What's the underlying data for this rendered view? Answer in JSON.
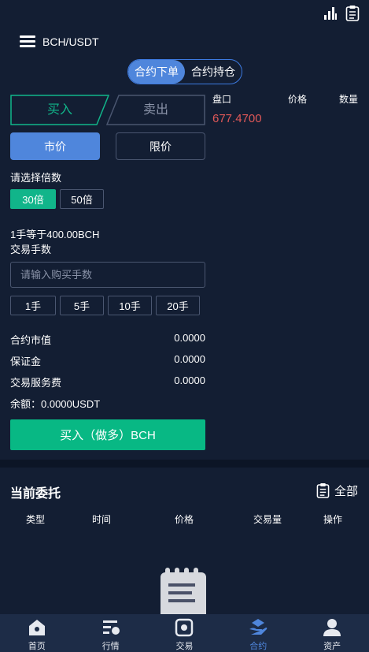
{
  "header": {
    "pair": "BCH/USDT"
  },
  "segment": {
    "tabs": [
      "合约下单",
      "合约持仓"
    ],
    "active": 0
  },
  "trade": {
    "buy_label": "买入",
    "sell_label": "卖出",
    "market_label": "市价",
    "limit_label": "限价",
    "leverage_title": "请选择倍数",
    "leverages": [
      "30倍",
      "50倍"
    ],
    "lot_info": "1手等于400.00BCH",
    "qty_title": "交易手数",
    "qty_placeholder": "请输入购买手数",
    "qty_chips": [
      "1手",
      "5手",
      "10手",
      "20手"
    ],
    "contract_value_label": "合约市值",
    "contract_value": "0.0000",
    "margin_label": "保证金",
    "margin": "0.0000",
    "fee_label": "交易服务费",
    "fee": "0.0000",
    "balance": "余额：0.0000USDT",
    "submit_label": "买入（做多）BCH"
  },
  "orderbook": {
    "title": "盘口",
    "price_header": "价格",
    "qty_header": "数量",
    "last_price": "677.4700"
  },
  "orders": {
    "title": "当前委托",
    "all_label": "全部",
    "columns": [
      "类型",
      "时间",
      "价格",
      "交易量",
      "操作"
    ]
  },
  "tabbar": {
    "items": [
      {
        "label": "首页",
        "icon": "home-icon"
      },
      {
        "label": "行情",
        "icon": "market-icon"
      },
      {
        "label": "交易",
        "icon": "trade-icon"
      },
      {
        "label": "合约",
        "icon": "contract-icon"
      },
      {
        "label": "资产",
        "icon": "user-icon"
      }
    ],
    "active": 3
  },
  "colors": {
    "accent": "#4f86dc",
    "buy": "#08b884",
    "price": "#e05858",
    "bg": "#131e33"
  }
}
